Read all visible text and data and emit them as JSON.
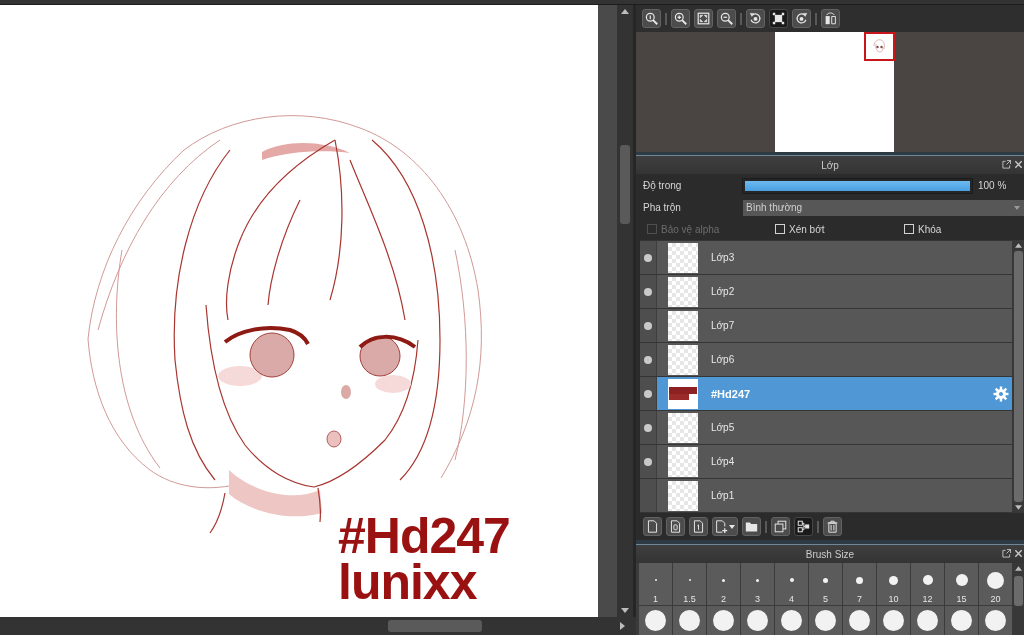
{
  "canvas": {
    "texts": [
      "#Hd247",
      "lunixx"
    ]
  },
  "navigator": {
    "tool_groups": [
      {
        "buttons": [
          {
            "kind": "actual-size",
            "active": false
          }
        ]
      },
      {
        "buttons": [
          {
            "kind": "zoom-in",
            "active": false
          },
          {
            "kind": "fit",
            "active": false
          },
          {
            "kind": "zoom-out",
            "active": false
          }
        ]
      },
      {
        "buttons": [
          {
            "kind": "rotate-left",
            "active": false
          },
          {
            "kind": "reset-rotation",
            "active": true
          },
          {
            "kind": "rotate-right",
            "active": false
          }
        ]
      },
      {
        "buttons": [
          {
            "kind": "flip",
            "active": false
          }
        ]
      }
    ]
  },
  "layer_panel": {
    "title": "Lớp",
    "opacity": {
      "label": "Độ trong",
      "level": 1,
      "reading": "100 %"
    },
    "blend_mode": {
      "label": "Pha trộn",
      "value": "Bình thường"
    },
    "options": [
      {
        "label": "Bảo vệ alpha",
        "checked": false,
        "disabled": true
      },
      {
        "label": "Xén bớt",
        "checked": false,
        "disabled": false
      },
      {
        "label": "Khóa",
        "checked": false,
        "disabled": false
      }
    ],
    "layers": [
      {
        "name": "Lớp3",
        "kind": "raster",
        "visible": true,
        "selected": false
      },
      {
        "name": "Lớp2",
        "kind": "raster",
        "visible": true,
        "selected": false
      },
      {
        "name": "Lớp7",
        "kind": "raster",
        "visible": true,
        "selected": false
      },
      {
        "name": "Lớp6",
        "kind": "raster",
        "visible": true,
        "selected": false
      },
      {
        "name": "#Hd247",
        "kind": "text",
        "visible": true,
        "selected": true
      },
      {
        "name": "Lớp5",
        "kind": "raster",
        "visible": true,
        "selected": false
      },
      {
        "name": "Lớp4",
        "kind": "raster",
        "visible": true,
        "selected": false
      },
      {
        "name": "Lớp1",
        "kind": "raster",
        "visible": false,
        "selected": false
      }
    ],
    "toolbar_groups": [
      {
        "buttons": [
          {
            "kind": "new-layer",
            "active": false
          },
          {
            "kind": "new-8bit-layer",
            "active": false
          },
          {
            "kind": "new-1bit-layer",
            "active": false
          },
          {
            "kind": "add-menu",
            "active": false
          },
          {
            "kind": "folder",
            "active": false
          }
        ]
      },
      {
        "buttons": [
          {
            "kind": "duplicate",
            "active": false
          },
          {
            "kind": "merge",
            "active": true
          }
        ]
      },
      {
        "buttons": [
          {
            "kind": "delete",
            "active": false
          }
        ]
      }
    ]
  },
  "brush_panel": {
    "title": "Brush Size",
    "sizes": [
      "1",
      "1.5",
      "2",
      "3",
      "4",
      "5",
      "7",
      "10",
      "12",
      "15",
      "20"
    ]
  }
}
